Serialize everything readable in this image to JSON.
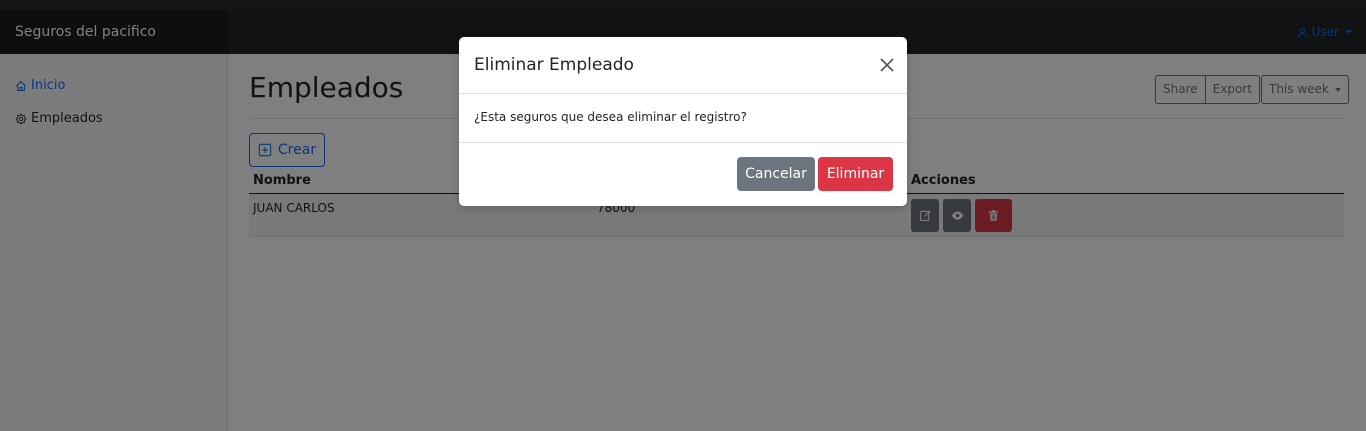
{
  "navbar": {
    "brand": "Seguros del pacifico",
    "user_label": "User"
  },
  "sidebar": {
    "items": [
      {
        "label": "Inicio",
        "icon": "home-icon"
      },
      {
        "label": "Empleados",
        "icon": "gear-icon"
      }
    ]
  },
  "main": {
    "title": "Empleados",
    "share_label": "Share",
    "export_label": "Export",
    "week_label": "This week",
    "create_label": "Crear"
  },
  "table": {
    "headers": [
      "Nombre",
      "Acciones"
    ],
    "rows": [
      {
        "nombre": "JUAN CARLOS",
        "valor": "78000"
      }
    ]
  },
  "modal": {
    "title": "Eliminar Empleado",
    "message": "¿Esta seguros que desea eliminar el registro?",
    "cancel_label": "Cancelar",
    "delete_label": "Eliminar"
  },
  "colors": {
    "primary": "#0d6efd",
    "secondary": "#6c757d",
    "danger": "#dc3545",
    "navbar": "#212529"
  }
}
